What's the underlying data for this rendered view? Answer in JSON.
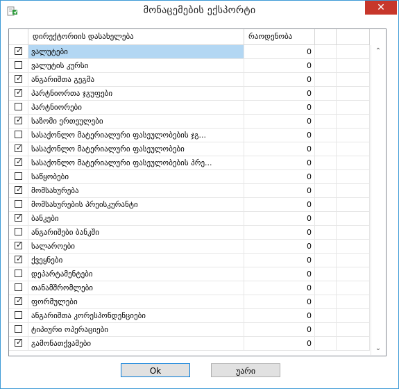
{
  "window": {
    "title": "მონაცემების ექსპორტი"
  },
  "grid": {
    "columns": {
      "name": "დირექტორიის დასახელება",
      "count": "რაოდენობა"
    },
    "rows": [
      {
        "checked": true,
        "name": "ვალუტები",
        "count": "0"
      },
      {
        "checked": false,
        "name": "ვალუტის კურსი",
        "count": "0"
      },
      {
        "checked": true,
        "name": "ანგარიშთა გეგმა",
        "count": "0"
      },
      {
        "checked": true,
        "name": "პარტნიორთა ჯგუფები",
        "count": "0"
      },
      {
        "checked": false,
        "name": "პარტნიორები",
        "count": "0"
      },
      {
        "checked": true,
        "name": "საზომი ერთეულები",
        "count": "0"
      },
      {
        "checked": false,
        "name": "სასაქონლო მატერიალური ფასეულობების ჯგ...",
        "count": "0"
      },
      {
        "checked": true,
        "name": "სასაქონლო მატერიალური ფასეულობები",
        "count": "0"
      },
      {
        "checked": true,
        "name": "სასაქონლო მატერიალური ფასეულობების პრე...",
        "count": "0"
      },
      {
        "checked": false,
        "name": "საწყობები",
        "count": "0"
      },
      {
        "checked": true,
        "name": "მომსახურება",
        "count": "0"
      },
      {
        "checked": false,
        "name": "მომსახურების პრეისკურანტი",
        "count": "0"
      },
      {
        "checked": true,
        "name": "ბანკები",
        "count": "0"
      },
      {
        "checked": false,
        "name": "ანგარიშები ბანკში",
        "count": "0"
      },
      {
        "checked": true,
        "name": "სალაროები",
        "count": "0"
      },
      {
        "checked": true,
        "name": "ქვეყნები",
        "count": "0"
      },
      {
        "checked": false,
        "name": "დეპარტამენტები",
        "count": "0"
      },
      {
        "checked": false,
        "name": "თანამშრომლები",
        "count": "0"
      },
      {
        "checked": true,
        "name": "ფორმულები",
        "count": "0"
      },
      {
        "checked": false,
        "name": "ანგარიშთა კორესპონდენციები",
        "count": "0"
      },
      {
        "checked": false,
        "name": "ტიპიური ოპერაციები",
        "count": "0"
      },
      {
        "checked": true,
        "name": "გამონათქვამები",
        "count": "0"
      }
    ],
    "selected_row": 0
  },
  "buttons": {
    "ok": "Ok",
    "cancel": "უარი"
  },
  "icons": {
    "close": "close-icon",
    "app": "app-icon",
    "scroll_up": "chevron-up-icon",
    "scroll_down": "chevron-down-icon",
    "check": "checkmark-icon"
  },
  "colors": {
    "selection": "#b3d7f3",
    "close": "#c7372b",
    "border": "#3c9ad6"
  }
}
